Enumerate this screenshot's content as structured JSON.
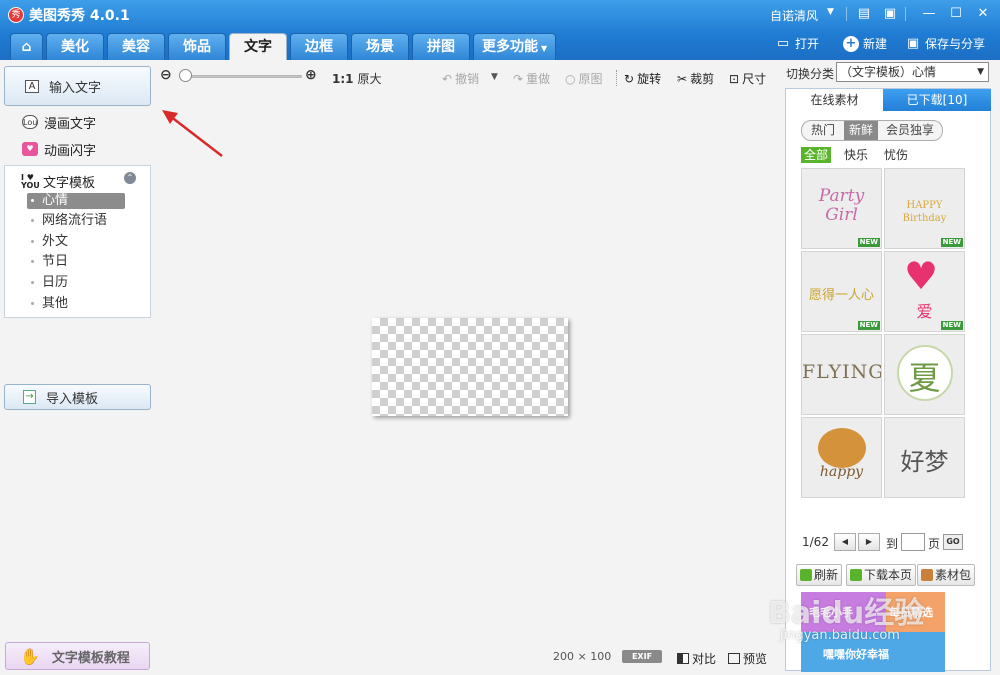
{
  "app": {
    "title": "美图秀秀 4.0.1",
    "logo_text": "秀"
  },
  "window": {
    "skin": "自诺清风"
  },
  "tabs": [
    {
      "label": ""
    },
    {
      "label": "美化"
    },
    {
      "label": "美容"
    },
    {
      "label": "饰品"
    },
    {
      "label": "文字"
    },
    {
      "label": "边框"
    },
    {
      "label": "场景"
    },
    {
      "label": "拼图"
    },
    {
      "label": "更多功能"
    }
  ],
  "topbar": {
    "open": "打开",
    "new": "新建",
    "save": "保存与分享"
  },
  "left": {
    "input_text": "输入文字",
    "comic_text": "漫画文字",
    "animated_text": "动画闪字",
    "template_header": "文字模板",
    "template_logo": "I ♥ YOU",
    "template_items": [
      "心情",
      "网络流行语",
      "外文",
      "节日",
      "日历",
      "其他"
    ],
    "import_template": "导入模板",
    "tutorial": "文字模板教程"
  },
  "toolbar": {
    "original_size_ratio": "1:1",
    "original_size": "原大",
    "undo": "撤销",
    "redo": "重做",
    "original_image": "原图",
    "rotate": "旋转",
    "crop": "裁剪",
    "resize": "尺寸"
  },
  "status": {
    "dimensions": "200 × 100",
    "exif": "EXIF",
    "compare": "对比",
    "preview": "预览"
  },
  "right": {
    "category_label": "切换分类",
    "category_value": "（文字模板）心情",
    "tab_online": "在线素材",
    "tab_downloaded": "已下载[10]",
    "segments": [
      "热门",
      "新鲜",
      "会员独享"
    ],
    "filters": [
      "全部",
      "快乐",
      "忧伤"
    ],
    "new_badge": "NEW",
    "thumbs": [
      {
        "text": "Party Girl",
        "new": true
      },
      {
        "text": "HAPPY Birthday",
        "new": true
      },
      {
        "text": "愿得一人心",
        "new": true
      },
      {
        "text": "爱",
        "new": true
      },
      {
        "text": "FLYING",
        "new": false
      },
      {
        "text": "夏",
        "new": false
      },
      {
        "text": "happy",
        "new": false
      },
      {
        "text": "好梦",
        "new": false
      }
    ],
    "pager": {
      "page": "1/62",
      "goto": "到",
      "unit": "页",
      "go": "GO"
    },
    "actions": {
      "refresh": "刷新",
      "download_page": "下载本页",
      "material_pack": "素材包"
    },
    "banner": {
      "left": "毛毛小手",
      "right": "每日精选",
      "bottom": "嘿嘿你好幸福"
    }
  },
  "watermark": {
    "main": "Baidu经验",
    "url": "jingyan.baidu.com"
  },
  "colors": {
    "titlebar": "#2b88dc",
    "accent_green": "#59b32b",
    "arrow": "#d92a2a"
  }
}
